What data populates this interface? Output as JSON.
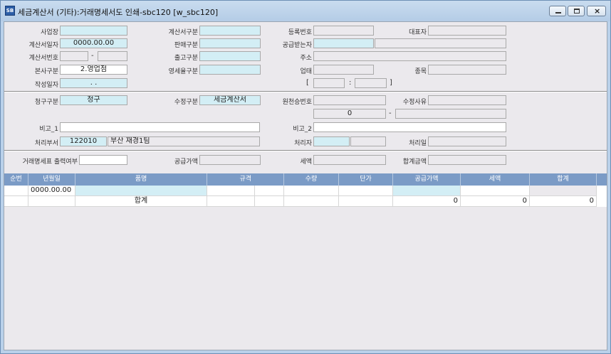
{
  "window": {
    "title": "세금계산서 (기타):거래명세서도 인쇄-sbc120 [w_sbc120]",
    "icon_text": "SB",
    "controls": {
      "minimize": "minimize-icon",
      "maximize": "maximize-icon",
      "close": "×"
    }
  },
  "form": {
    "business_site": {
      "label": "사업장",
      "value": ""
    },
    "invoice_type": {
      "label": "계산서구분",
      "value": ""
    },
    "reg_no": {
      "label": "등록번호",
      "value": ""
    },
    "representative": {
      "label": "대표자",
      "value": ""
    },
    "invoice_date": {
      "label": "계산서일자",
      "value": "0000.00.00"
    },
    "sales_type": {
      "label": "판매구분",
      "value": ""
    },
    "recipient": {
      "label": "공급받는자",
      "value": "",
      "value2": ""
    },
    "invoice_no": {
      "label": "계산서번호",
      "value": "",
      "dash": "-",
      "value2": ""
    },
    "shipment_type": {
      "label": "출고구분",
      "value": ""
    },
    "address": {
      "label": "주소",
      "value": ""
    },
    "branch_type": {
      "label": "본사구분",
      "value": "2.영업점"
    },
    "zero_tax_type": {
      "label": "영세율구분",
      "value": ""
    },
    "business_type": {
      "label": "업태",
      "value": ""
    },
    "item_type": {
      "label": "종목",
      "value": ""
    },
    "created_date": {
      "label": "작성일자",
      "value": ". ."
    },
    "bracket_open": "[",
    "colon": ":",
    "bracket_close": "]",
    "claim_type": {
      "label": "청구구분",
      "value": "청구"
    },
    "modify_type": {
      "label": "수정구분",
      "value": "세금계산서"
    },
    "orig_approval_no": {
      "label": "원천승번호",
      "value": "",
      "value2": "0",
      "dash": "-",
      "value3": ""
    },
    "modify_reason": {
      "label": "수정사유",
      "value": ""
    },
    "note1": {
      "label": "비고_1",
      "value": ""
    },
    "note2": {
      "label": "비고_2",
      "value": ""
    },
    "dept": {
      "label": "처리부서",
      "code": "122010",
      "name": "부산 재경1팀"
    },
    "handler": {
      "label": "처리자",
      "value": "",
      "value2": ""
    },
    "handle_date": {
      "label": "처리일",
      "value": ""
    },
    "statement_print": {
      "label": "거래명세표 출력여부",
      "value": ""
    },
    "supply_amount": {
      "label": "공급가액",
      "value": ""
    },
    "tax": {
      "label": "세액",
      "value": ""
    },
    "total": {
      "label": "합계금액",
      "value": ""
    }
  },
  "grid": {
    "columns": [
      "순번",
      "년월일",
      "품명",
      "규격",
      "수량",
      "단가",
      "공급가액",
      "세액",
      "합계"
    ],
    "row1": [
      "",
      "0000.00.00",
      "",
      "",
      "",
      "",
      "",
      "",
      ""
    ],
    "summary": {
      "label": "합계",
      "supply": "0",
      "tax": "0",
      "total": "0"
    }
  }
}
